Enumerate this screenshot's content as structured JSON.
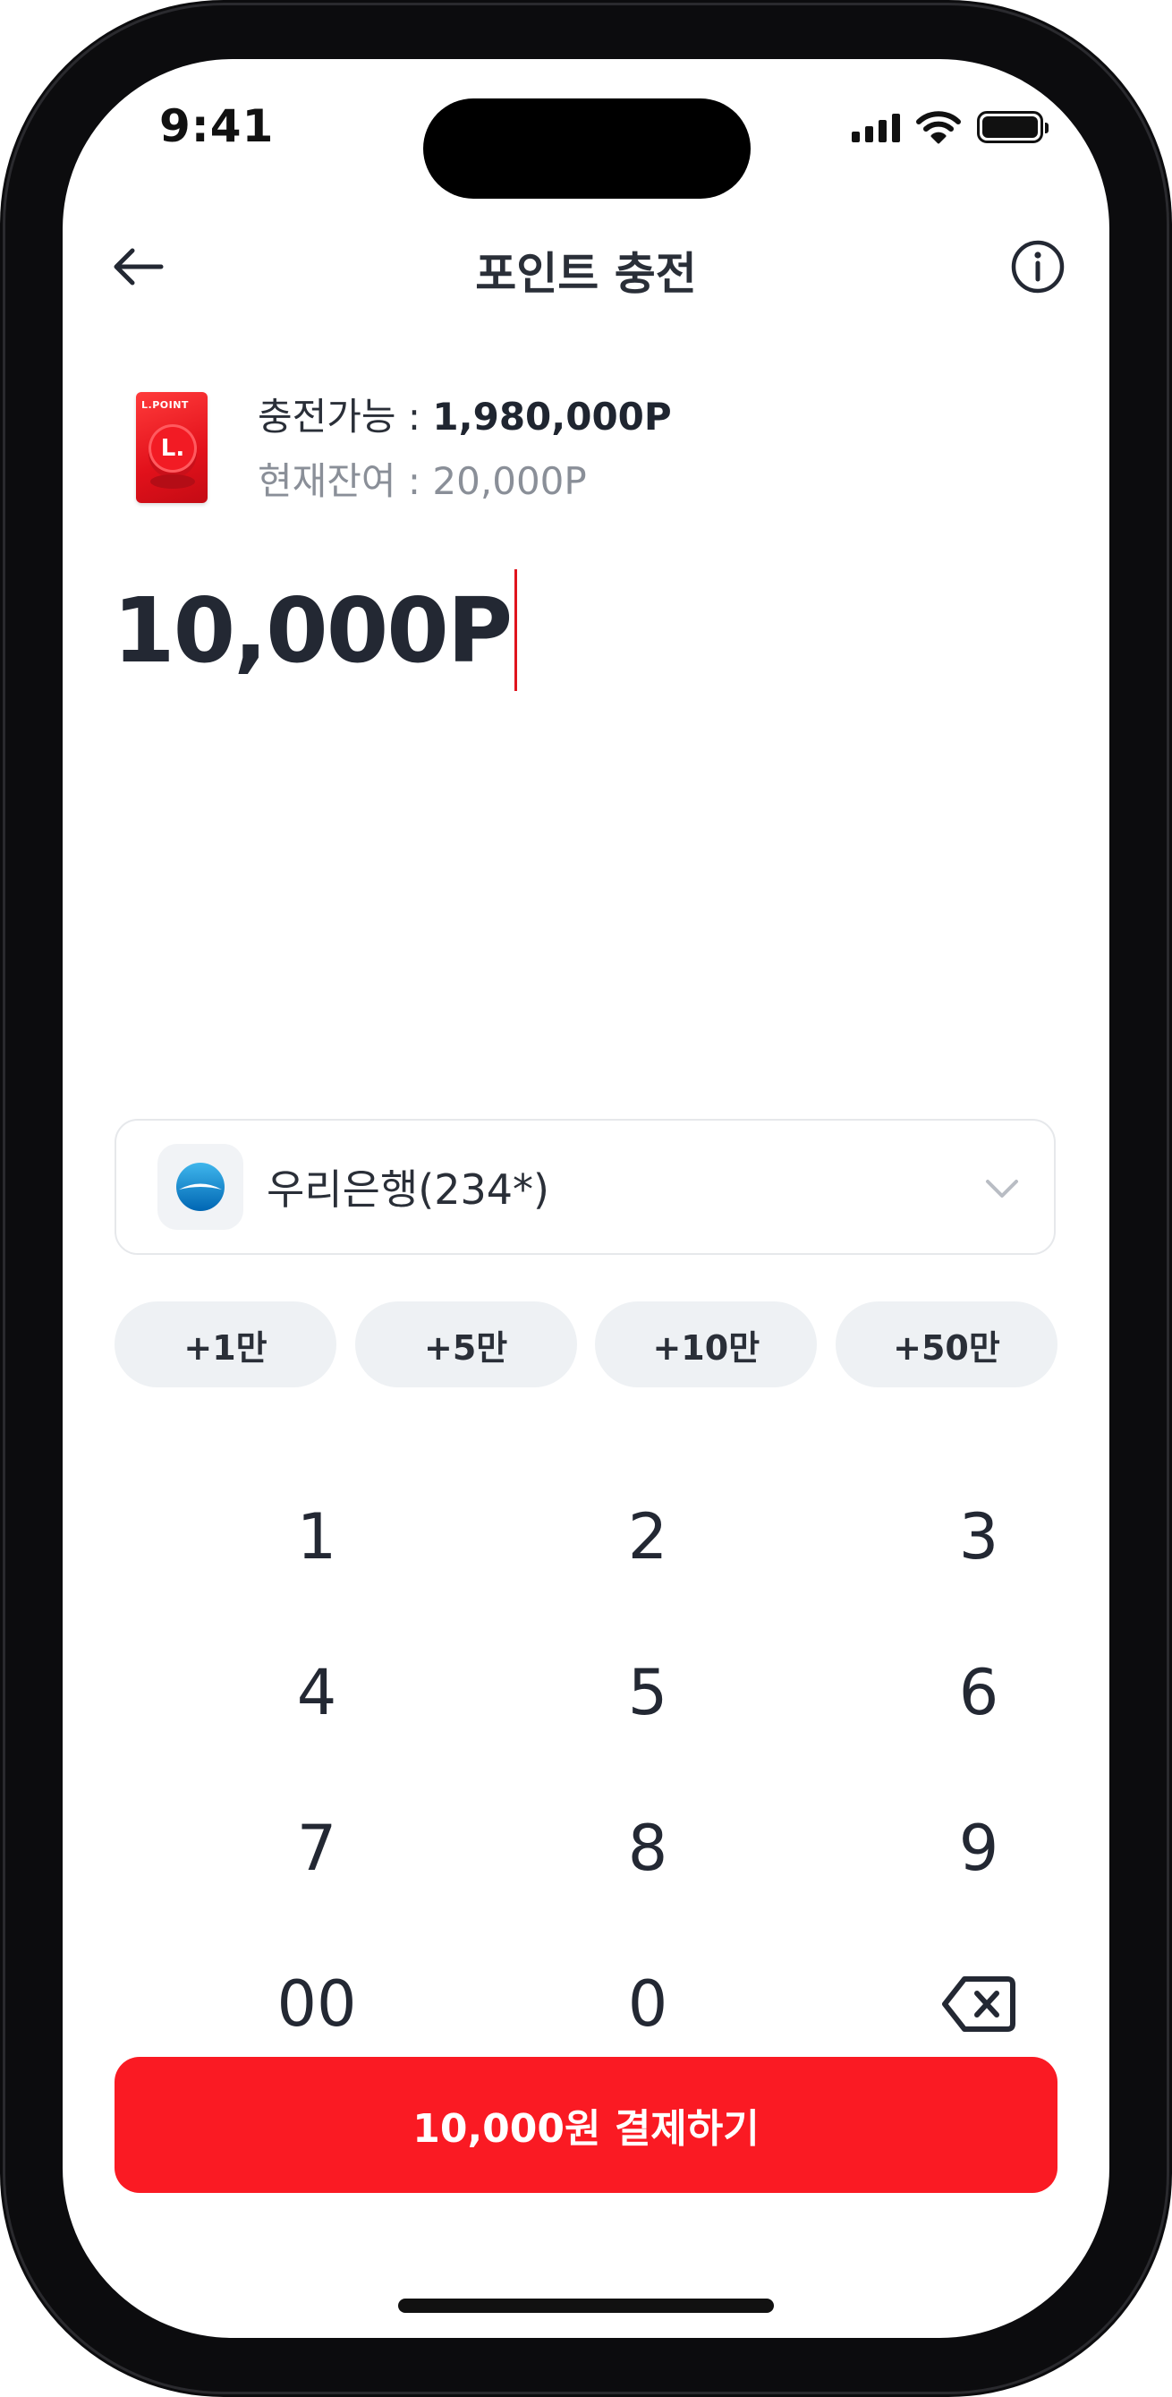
{
  "status_bar": {
    "time": "9:41"
  },
  "header": {
    "title": "포인트 충전"
  },
  "card": {
    "brand_text": "L.POINT",
    "coin_text": "L."
  },
  "info": {
    "available_label": "충전가능 : ",
    "available_value": "1,980,000P",
    "balance_label": "현재잔여 : ",
    "balance_value": "20,000P"
  },
  "amount": "10,000P",
  "bank": {
    "name": "우리은행(234*)"
  },
  "quick_amounts": [
    "+1만",
    "+5만",
    "+10만",
    "+50만"
  ],
  "keypad": [
    "1",
    "2",
    "3",
    "4",
    "5",
    "6",
    "7",
    "8",
    "9",
    "00",
    "0"
  ],
  "pay_button": "10,000원 결제하기",
  "colors": {
    "accent": "#fa1a23",
    "text": "#232833",
    "muted": "#8a8f98",
    "chip_bg": "#eef1f4"
  }
}
